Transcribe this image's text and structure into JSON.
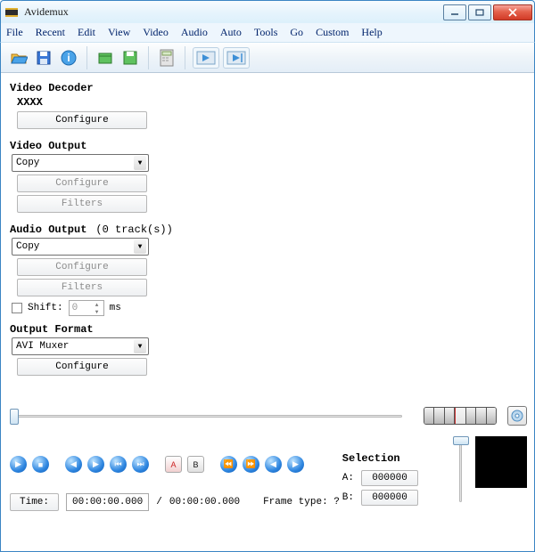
{
  "window": {
    "title": "Avidemux"
  },
  "menu": {
    "file": "File",
    "recent": "Recent",
    "edit": "Edit",
    "view": "View",
    "video": "Video",
    "audio": "Audio",
    "auto": "Auto",
    "tools": "Tools",
    "go": "Go",
    "custom": "Custom",
    "help": "Help"
  },
  "video_decoder": {
    "heading": "Video Decoder",
    "codec": "XXXX",
    "configure": "Configure"
  },
  "video_output": {
    "heading": "Video Output",
    "selected": "Copy",
    "configure": "Configure",
    "filters": "Filters"
  },
  "audio_output": {
    "heading": "Audio Output",
    "tracks": "(0 track(s))",
    "selected": "Copy",
    "configure": "Configure",
    "filters": "Filters",
    "shift_label": "Shift:",
    "shift_value": "0",
    "shift_unit": "ms"
  },
  "output_format": {
    "heading": "Output Format",
    "selected": "AVI Muxer",
    "configure": "Configure"
  },
  "time": {
    "button": "Time:",
    "current": "00:00:00.000",
    "sep": "/",
    "total": "00:00:00.000",
    "frame_type_label": "Frame type:",
    "frame_type_value": "?"
  },
  "selection": {
    "heading": "Selection",
    "a_label": "A:",
    "a_value": "000000",
    "b_label": "B:",
    "b_value": "000000"
  }
}
